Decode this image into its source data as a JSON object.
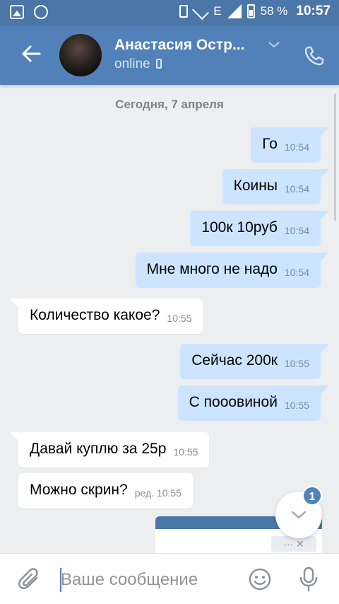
{
  "status_bar": {
    "network": "E",
    "battery": "58 %",
    "time": "10:57"
  },
  "header": {
    "contact_name": "Анастасия Остр...",
    "status": "online"
  },
  "chat": {
    "date_divider": "Сегодня, 7 апреля",
    "messages": [
      {
        "dir": "out",
        "text": "Го",
        "time": "10:54"
      },
      {
        "dir": "out",
        "text": "Коины",
        "time": "10:54"
      },
      {
        "dir": "out",
        "text": "100к 10руб",
        "time": "10:54"
      },
      {
        "dir": "out",
        "text": "Мне много не надо",
        "time": "10:54"
      },
      {
        "dir": "in",
        "text": "Количество какое?",
        "time": "10:55"
      },
      {
        "dir": "out",
        "text": "Сейчас 200к",
        "time": "10:55"
      },
      {
        "dir": "out",
        "text": "С пооовиной",
        "time": "10:55"
      },
      {
        "dir": "in",
        "text": "Давай куплю за 25р",
        "time": "10:55"
      },
      {
        "dir": "in",
        "text": "Можно скрин?",
        "time": "ред. 10:55"
      }
    ],
    "attachment_preview": {
      "controls": "···  ✕"
    },
    "unread_badge": "1"
  },
  "composer": {
    "placeholder": "Ваше сообщение"
  },
  "colors": {
    "header": "#5181b8",
    "status_bar": "#4a76a8",
    "outgoing_bubble": "#cce4ff",
    "background": "#edeef0"
  }
}
